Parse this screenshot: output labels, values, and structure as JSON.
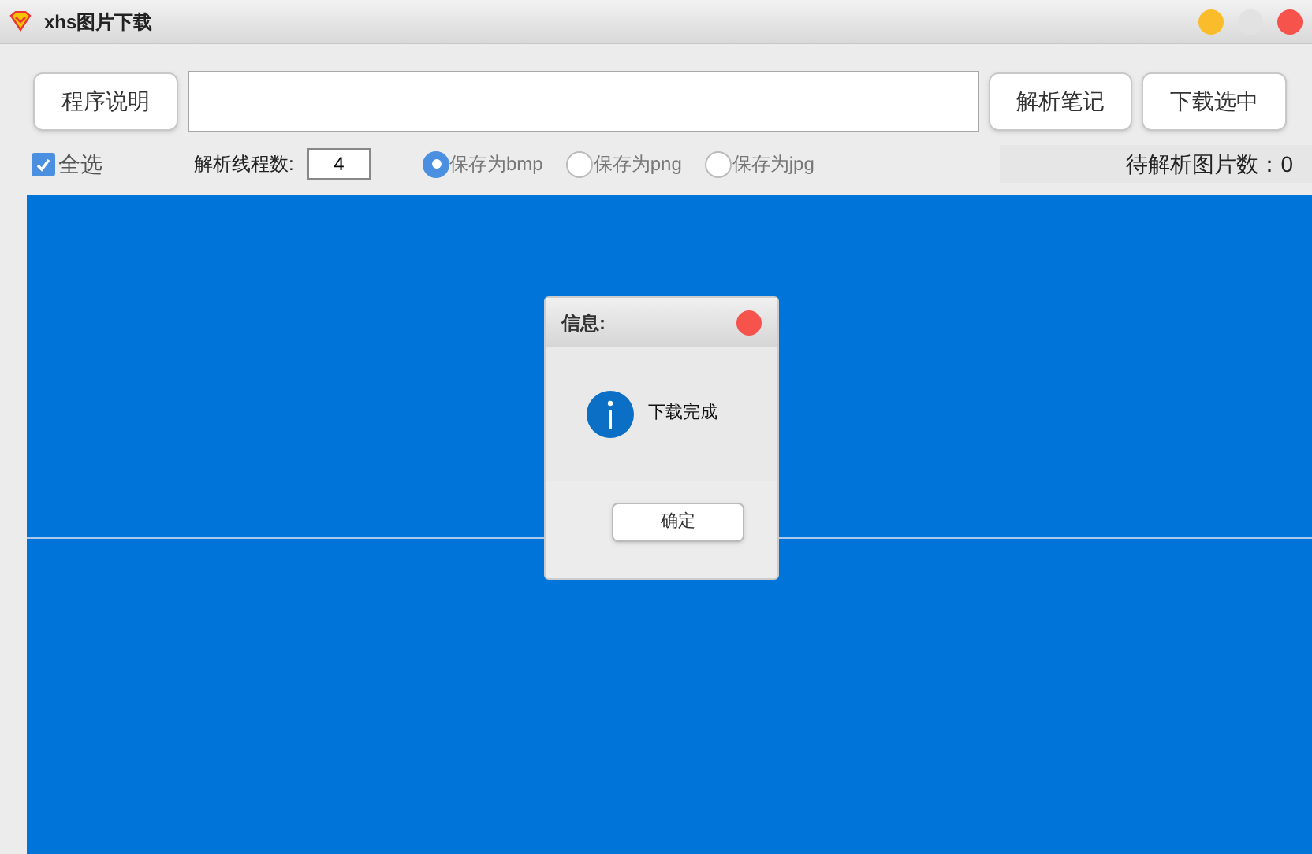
{
  "window": {
    "title": "xhs图片下载"
  },
  "toolbar": {
    "help_button": "程序说明",
    "parse_button": "解析笔记",
    "download_button": "下载选中"
  },
  "options": {
    "select_all": {
      "label": "全选",
      "checked": true
    },
    "threads": {
      "label": "解析线程数:",
      "value": "4"
    },
    "formats": [
      {
        "label": "保存为bmp",
        "selected": true
      },
      {
        "label": "保存为png",
        "selected": false
      },
      {
        "label": "保存为jpg",
        "selected": false
      }
    ],
    "pending": "待解析图片数：0"
  },
  "dialog": {
    "title": "信息:",
    "message": "下载完成",
    "button": "确定"
  }
}
